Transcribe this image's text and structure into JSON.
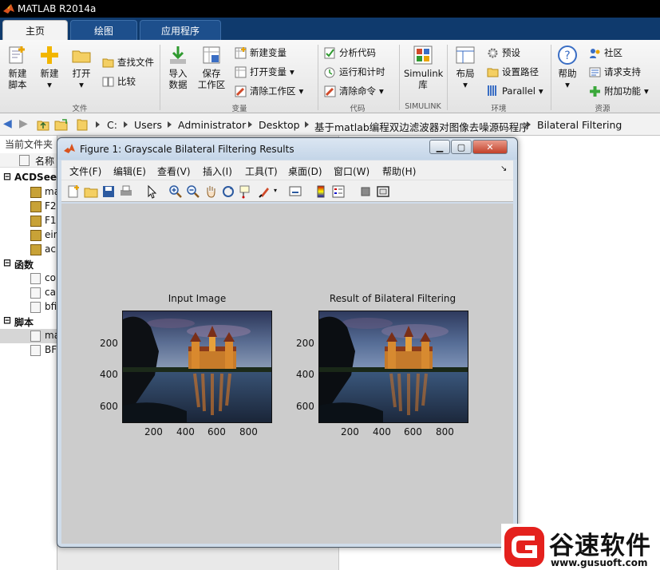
{
  "app": {
    "title": "MATLAB R2014a"
  },
  "tabs": [
    {
      "label": "主页",
      "active": true
    },
    {
      "label": "绘图",
      "active": false
    },
    {
      "label": "应用程序",
      "active": false
    }
  ],
  "ribbon": {
    "file": {
      "new_script": "新建\n脚本",
      "new": "新建",
      "open": "打开",
      "find_files": "查找文件",
      "compare": "比较",
      "section": "文件"
    },
    "variable": {
      "import": "导入\n数据",
      "save_ws": "保存\n工作区",
      "new_var": "新建变量",
      "open_var": "打开变量",
      "clear_ws": "清除工作区",
      "section": "变量"
    },
    "code": {
      "analyze": "分析代码",
      "run_time": "运行和计时",
      "clear_cmd": "清除命令",
      "section": "代码"
    },
    "simulink": {
      "lib": "Simulink\n库",
      "section": "SIMULINK"
    },
    "env": {
      "layout": "布局",
      "prefs": "预设",
      "set_path": "设置路径",
      "parallel": "Parallel",
      "section": "环境"
    },
    "resources": {
      "help": "帮助",
      "community": "社区",
      "support": "请求支持",
      "addons": "附加功能",
      "section": "资源"
    }
  },
  "breadcrumb": [
    "C:",
    "Users",
    "Administrator",
    "Desktop",
    "基于matlab编程双边滤波器对图像去噪源码程序",
    "Bilateral Filtering"
  ],
  "left_pane": {
    "header": "当前文件夹",
    "col_name": "名称",
    "groups": [
      {
        "label": "ACDSee",
        "items": [
          "ma",
          "F2",
          "F1",
          "ein",
          "ac"
        ]
      },
      {
        "label": "函数",
        "items": [
          "co",
          "ca",
          "bfi"
        ]
      },
      {
        "label": "脚本",
        "items": [
          "ma",
          "BF"
        ]
      }
    ]
  },
  "figure": {
    "title": "Figure 1: Grayscale Bilateral Filtering Results",
    "menu": [
      "文件(F)",
      "编辑(E)",
      "查看(V)",
      "插入(I)",
      "工具(T)",
      "桌面(D)",
      "窗口(W)",
      "帮助(H)"
    ],
    "toolbar_icons": [
      "new-figure-icon",
      "open-icon",
      "save-icon",
      "print-icon",
      "pointer-icon",
      "zoom-in-icon",
      "zoom-out-icon",
      "pan-icon",
      "rotate-icon",
      "data-cursor-icon",
      "brush-icon",
      "link-icon",
      "colorbar-icon",
      "legend-icon",
      "hide-plot-tools-icon",
      "show-plot-tools-icon"
    ],
    "axes": [
      {
        "title": "Input Image",
        "xticks": [
          "200",
          "400",
          "600",
          "800"
        ],
        "yticks": [
          "200",
          "400",
          "600"
        ]
      },
      {
        "title": "Result of Bilateral Filtering",
        "xticks": [
          "200",
          "400",
          "600",
          "800"
        ],
        "yticks": [
          "200",
          "400",
          "600"
        ]
      }
    ]
  },
  "watermark": {
    "brand": "谷速软件",
    "url": "www.gusuoft.com"
  },
  "colors": {
    "titlebar": "#000000",
    "tabbar": "#0f3a6d",
    "canvas": "#cccccc"
  }
}
